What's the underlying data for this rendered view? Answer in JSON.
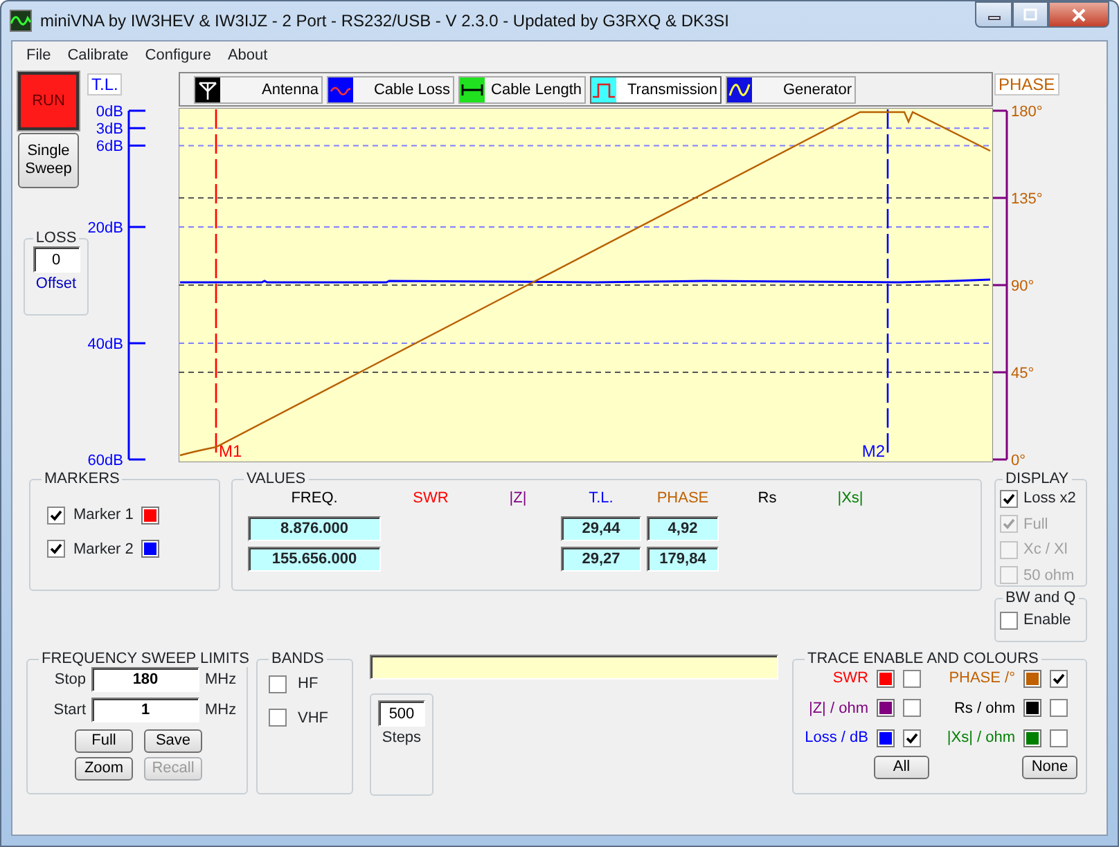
{
  "window": {
    "title": "miniVNA by IW3HEV & IW3IJZ - 2 Port - RS232/USB - V 2.3.0 - Updated by G3RXQ & DK3SI"
  },
  "menu": [
    "File",
    "Calibrate",
    "Configure",
    "About"
  ],
  "run_button": "RUN",
  "single_sweep_button": "Single Sweep",
  "loss": {
    "title": "LOSS",
    "value": "0",
    "label": "Offset"
  },
  "tabs": [
    {
      "label": "Antenna",
      "selected": false
    },
    {
      "label": "Cable Loss",
      "selected": false
    },
    {
      "label": "Cable Length",
      "selected": false
    },
    {
      "label": "Transmission",
      "selected": true
    },
    {
      "label": "Generator",
      "selected": false
    }
  ],
  "left_axis": {
    "title": "T.L.",
    "labels": [
      "0dB",
      "3dB",
      "6dB",
      "20dB",
      "40dB",
      "60dB"
    ]
  },
  "right_axis": {
    "title": "PHASE",
    "labels": [
      "180°",
      "135°",
      "90°",
      "45°",
      "0°"
    ]
  },
  "plot": {
    "markers": [
      {
        "label": "M1",
        "color": "#ff0000"
      },
      {
        "label": "M2",
        "color": "#0000ff"
      }
    ]
  },
  "markers": {
    "title": "MARKERS",
    "items": [
      {
        "label": "Marker 1",
        "checked": true,
        "color": "#ff0000"
      },
      {
        "label": "Marker 2",
        "checked": true,
        "color": "#0000ff"
      }
    ]
  },
  "values": {
    "title": "VALUES",
    "columns": [
      {
        "label": "FREQ.",
        "color": "#000000"
      },
      {
        "label": "SWR",
        "color": "#ff0000"
      },
      {
        "label": "|Z|",
        "color": "#800080"
      },
      {
        "label": "T.L.",
        "color": "#0000ff"
      },
      {
        "label": "PHASE",
        "color": "#c06000"
      },
      {
        "label": "Rs",
        "color": "#000000"
      },
      {
        "label": "|Xs|",
        "color": "#008000"
      }
    ],
    "rows": [
      {
        "freq": "8.876.000",
        "tl": "29,44",
        "phase": "4,92"
      },
      {
        "freq": "155.656.000",
        "tl": "29,27",
        "phase": "179,84"
      }
    ]
  },
  "display": {
    "title": "DISPLAY",
    "options": [
      {
        "label": "Loss x2",
        "checked": true,
        "disabled": false
      },
      {
        "label": "Full",
        "checked": true,
        "disabled": true
      },
      {
        "label": "Xc / Xl",
        "checked": false,
        "disabled": true
      },
      {
        "label": "50 ohm",
        "checked": false,
        "disabled": true
      }
    ]
  },
  "bw_q": {
    "title": "BW and Q",
    "options": [
      {
        "label": "Enable",
        "checked": false,
        "disabled": false
      }
    ]
  },
  "sweep": {
    "title": "FREQUENCY SWEEP LIMITS",
    "fields": [
      {
        "label": "Stop",
        "value": "180",
        "unit": "MHz"
      },
      {
        "label": "Start",
        "value": "1",
        "unit": "MHz"
      }
    ],
    "buttons": [
      {
        "label": "Full",
        "disabled": false
      },
      {
        "label": "Save",
        "disabled": false
      },
      {
        "label": "Zoom",
        "disabled": false
      },
      {
        "label": "Recall",
        "disabled": true
      }
    ]
  },
  "bands": {
    "title": "BANDS",
    "options": [
      {
        "label": "HF",
        "checked": false,
        "disabled": false
      },
      {
        "label": "VHF",
        "checked": false,
        "disabled": false
      }
    ]
  },
  "steps": {
    "value": "500",
    "label": "Steps"
  },
  "traces": {
    "title": "TRACE ENABLE AND COLOURS",
    "items": [
      {
        "label": "SWR",
        "color": "#ff0000",
        "checked": false
      },
      {
        "label": "PHASE /°",
        "color": "#c06000",
        "checked": true
      },
      {
        "label": "|Z| / ohm",
        "color": "#800080",
        "checked": false
      },
      {
        "label": "Rs / ohm",
        "color": "#000000",
        "checked": false
      },
      {
        "label": "Loss / dB",
        "color": "#0000ff",
        "checked": true
      },
      {
        "label": "|Xs| / ohm",
        "color": "#008000",
        "checked": false
      }
    ],
    "buttons": [
      "All",
      "None"
    ]
  }
}
